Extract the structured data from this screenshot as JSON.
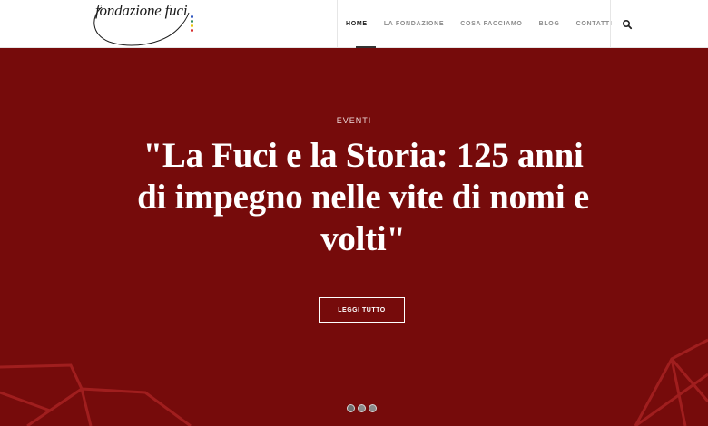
{
  "brand": {
    "logo_text": "fondazione fuci",
    "dot_colors": [
      "#2a52be",
      "#2e8b57",
      "#e8c200",
      "#d62828"
    ]
  },
  "nav": {
    "items": [
      {
        "label": "HOME",
        "active": true
      },
      {
        "label": "LA FONDAZIONE",
        "active": false
      },
      {
        "label": "COSA FACCIAMO",
        "active": false
      },
      {
        "label": "BLOG",
        "active": false
      },
      {
        "label": "CONTATTI",
        "active": false
      }
    ],
    "search_icon": "search-icon"
  },
  "hero": {
    "background_color": "#760b0b",
    "category": "EVENTI",
    "headline": "\"La Fuci e la Storia: 125 anni di impegno nelle vite di nomi e volti\"",
    "button_label": "LEGGI TUTTO",
    "slides": 3,
    "active_slide": 1
  }
}
